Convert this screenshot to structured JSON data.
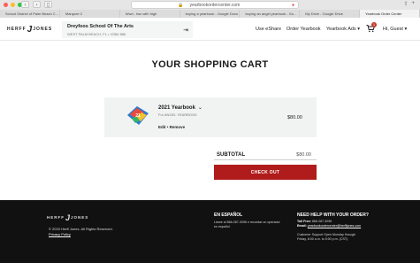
{
  "browser": {
    "url": "yearbookordercenter.com",
    "tabs": [
      {
        "label": "School District of Palm Beach C...",
        "active": false
      },
      {
        "label": "Marquee 2",
        "active": false
      },
      {
        "label": "Wwd - two with high",
        "active": false
      },
      {
        "label": "buying a yearbook - Google Docs",
        "active": false
      },
      {
        "label": "buying an angel yearbook - Go...",
        "active": false
      },
      {
        "label": "My Drive - Google Drive",
        "active": false
      },
      {
        "label": "Yearbook Order Center",
        "active": true
      }
    ]
  },
  "header": {
    "logo_left": "HERFF",
    "logo_mark": "J",
    "logo_right": "JONES",
    "school_name": "Dreyfoos School Of The Arts",
    "school_location": "WEST PALM BEACH, FL • JOB# 886",
    "nav": {
      "eshare": "Use eShare",
      "order_yearbook": "Order Yearbook",
      "yearbook_ads": "Yearbook Ads ▾",
      "cart_count": "1",
      "greeting": "Hi, Guest ▾"
    }
  },
  "page": {
    "title": "YOUR SHOPPING CART"
  },
  "cart": {
    "item": {
      "name": "2021 Yearbook",
      "for_text": "For ANGEL YEARBOOK",
      "actions": "Edit • Remove",
      "price": "$80.00"
    },
    "subtotal_label": "SUBTOTAL",
    "subtotal_value": "$80.00",
    "checkout_label": "CHECK OUT"
  },
  "footer": {
    "logo_left": "HERFF",
    "logo_mark": "J",
    "logo_right": "JONES",
    "copyright": "© 2020 Herff Jones. All Rights Reserved.",
    "privacy": "Privacy Policy",
    "espanol_title": "EN ESPAÑOL",
    "espanol_line1": "Llame al 866-287-3096 e recordar un operador",
    "espanol_line2": "en español.",
    "help_title": "NEED HELP WITH YOUR ORDER?",
    "toll_free_label": "Toll Free:",
    "toll_free_value": "866-287-3096",
    "email_label": "Email:",
    "email_value": "yearbookordercenter@herffjones.com",
    "hours_line1": "Customer Support Open Monday through",
    "hours_line2": "Friday, 8:00 a.m. to 5:00 p.m. (CST)."
  },
  "colors": {
    "accent": "#b01b1b",
    "footer_bg": "#111111",
    "panel_bg": "#f1f3f2"
  }
}
